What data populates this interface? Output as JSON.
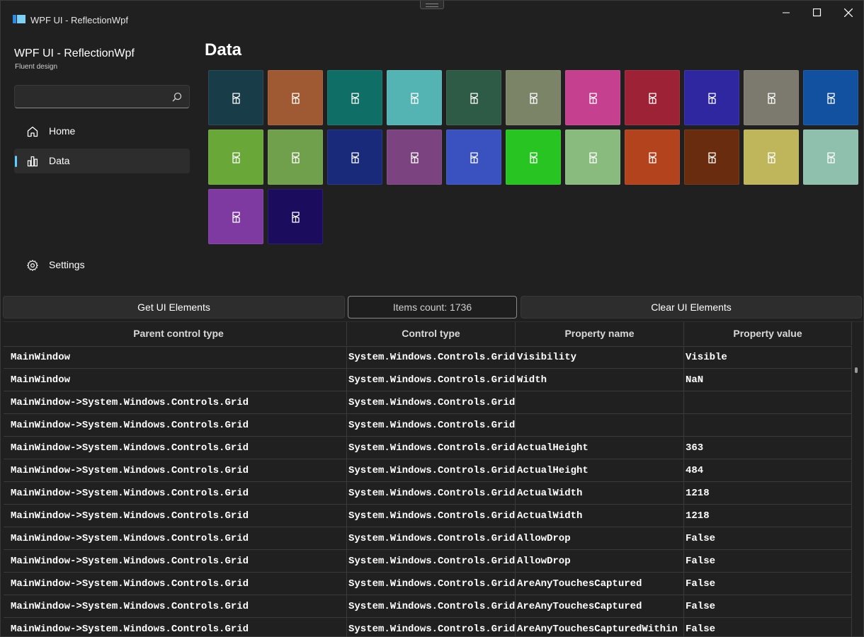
{
  "window": {
    "title": "WPF UI - ReflectionWpf",
    "controls": [
      "minimize-icon",
      "maximize-icon",
      "close-icon"
    ]
  },
  "sidebar": {
    "app_name": "WPF UI - ReflectionWpf",
    "app_subtitle": "Fluent design",
    "search": {
      "value": "",
      "placeholder": ""
    },
    "items": [
      {
        "label": "Home",
        "icon": "home-icon",
        "active": false
      },
      {
        "label": "Data",
        "icon": "chart-icon",
        "active": true
      }
    ],
    "footer_items": [
      {
        "label": "Settings",
        "icon": "gear-icon"
      }
    ]
  },
  "main": {
    "title": "Data",
    "tiles": [
      "#183d49",
      "#a05a33",
      "#0f6e65",
      "#54b4b3",
      "#2d5b45",
      "#7c8468",
      "#c54190",
      "#9e2236",
      "#2f27a0",
      "#7c7a6e",
      "#1151a0",
      "#69a838",
      "#71a04d",
      "#1a2a7a",
      "#7b4380",
      "#3a52c0",
      "#28c422",
      "#89bb7e",
      "#b2431d",
      "#6a2c0e",
      "#bfb55a",
      "#8fbfad",
      "#7e3aa0",
      "#1c0c5e"
    ]
  },
  "actions": {
    "get_label": "Get UI Elements",
    "count_label": "Items count: 1736",
    "clear_label": "Clear UI Elements"
  },
  "grid": {
    "columns": [
      "Parent control type",
      "Control type",
      "Property name",
      "Property value"
    ],
    "rows": [
      [
        "MainWindow",
        "System.Windows.Controls.Grid",
        "Visibility",
        "Visible"
      ],
      [
        "MainWindow",
        "System.Windows.Controls.Grid",
        "Width",
        "NaN"
      ],
      [
        "MainWindow->System.Windows.Controls.Grid",
        "System.Windows.Controls.Grid",
        "",
        ""
      ],
      [
        "MainWindow->System.Windows.Controls.Grid",
        "System.Windows.Controls.Grid",
        "",
        ""
      ],
      [
        "MainWindow->System.Windows.Controls.Grid",
        "System.Windows.Controls.Grid",
        "ActualHeight",
        "363"
      ],
      [
        "MainWindow->System.Windows.Controls.Grid",
        "System.Windows.Controls.Grid",
        "ActualHeight",
        "484"
      ],
      [
        "MainWindow->System.Windows.Controls.Grid",
        "System.Windows.Controls.Grid",
        "ActualWidth",
        "1218"
      ],
      [
        "MainWindow->System.Windows.Controls.Grid",
        "System.Windows.Controls.Grid",
        "ActualWidth",
        "1218"
      ],
      [
        "MainWindow->System.Windows.Controls.Grid",
        "System.Windows.Controls.Grid",
        "AllowDrop",
        "False"
      ],
      [
        "MainWindow->System.Windows.Controls.Grid",
        "System.Windows.Controls.Grid",
        "AllowDrop",
        "False"
      ],
      [
        "MainWindow->System.Windows.Controls.Grid",
        "System.Windows.Controls.Grid",
        "AreAnyTouchesCaptured",
        "False"
      ],
      [
        "MainWindow->System.Windows.Controls.Grid",
        "System.Windows.Controls.Grid",
        "AreAnyTouchesCaptured",
        "False"
      ],
      [
        "MainWindow->System.Windows.Controls.Grid",
        "System.Windows.Controls.Grid",
        "AreAnyTouchesCapturedWithin",
        "False"
      ]
    ]
  },
  "colors": {
    "background": "#202020",
    "accent": "#60cdff"
  }
}
